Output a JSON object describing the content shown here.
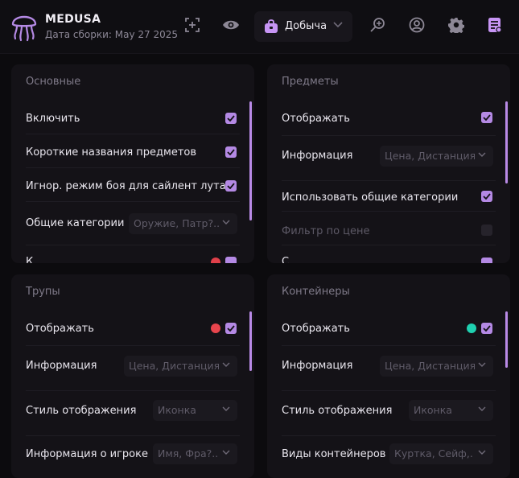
{
  "app": {
    "title": "MEDUSA",
    "build_date": "Дата сборки: May 27 2025",
    "logo_icon": "jellyfish-icon",
    "accent_color": "#b489e4"
  },
  "toolbar": {
    "icons": [
      "crosshair-add-icon",
      "eye-icon",
      "loot-bag-icon",
      "search-zoom-icon",
      "user-icon",
      "gear-icon",
      "settings-list-icon"
    ],
    "active_tab_label": "Добыча"
  },
  "panels": {
    "basic": {
      "title": "Основные",
      "rows": {
        "enable": "Включить",
        "short_names": "Короткие названия предметов",
        "ignore_combat": "Игнор. режим боя для сайлент лута",
        "common_categories": "Общие категории",
        "partial": "К"
      },
      "common_categories_value": "Оружие, Патр?..",
      "partial_dot_color": "#e0404a"
    },
    "items": {
      "title": "Предметы",
      "rows": {
        "display": "Отображать",
        "info": "Информация",
        "use_common": "Использовать общие категории",
        "price_filter": "Фильтр по цене",
        "partial": "С"
      },
      "info_value": "Цена, Дистанция"
    },
    "corpses": {
      "title": "Трупы",
      "rows": {
        "display": "Отображать",
        "info": "Информация",
        "style": "Стиль отображения",
        "player_info": "Информация о игроке"
      },
      "info_value": "Цена, Дистанция",
      "style_value": "Иконка",
      "player_info_value": "Имя, Фра?..",
      "dot_color": "#e8454d"
    },
    "containers": {
      "title": "Контейнеры",
      "rows": {
        "display": "Отображать",
        "info": "Информация",
        "style": "Стиль отображения",
        "types": "Виды контейнеров"
      },
      "info_value": "Цена, Дистанция",
      "style_value": "Иконка",
      "types_value": "Куртка, Сейф,...",
      "dot_color": "#1fd0b0"
    }
  }
}
